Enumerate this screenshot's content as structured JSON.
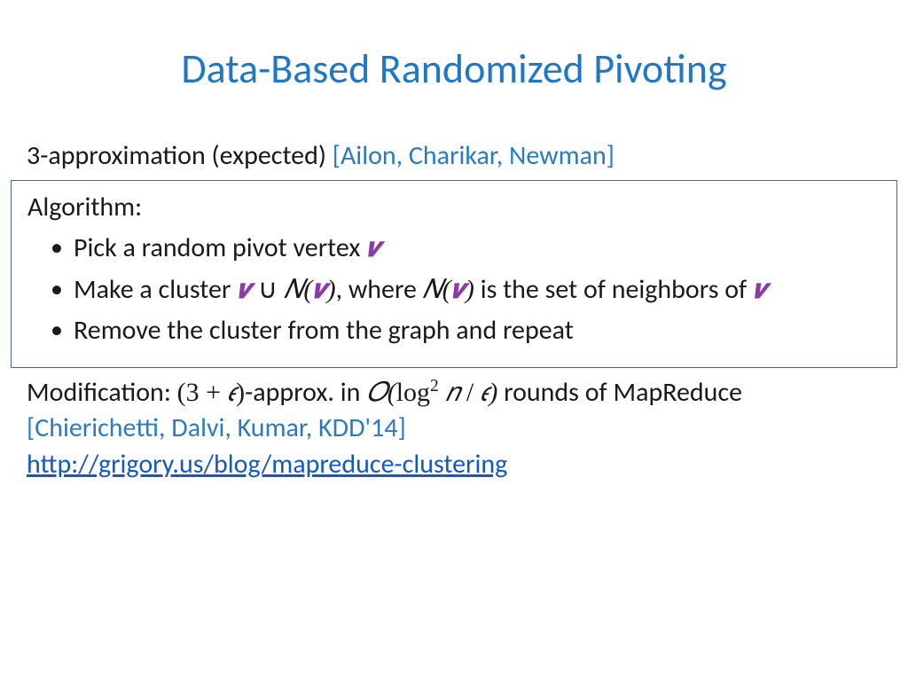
{
  "title": "Data-Based Randomized Pivoting",
  "approx_prefix": "3-approximation (expected) ",
  "citation1": "[Ailon, Charikar, Newman]",
  "algorithm_label": "Algorithm:",
  "bullet1_pre": "Pick a random pivot vertex ",
  "bullet2_pre": "Make a cluster ",
  "bullet2_mid1": ", where ",
  "bullet2_mid2": " is the set of neighbors of ",
  "bullet3": "Remove the cluster from the graph and repeat",
  "mod_prefix": "Modification: ",
  "mod_approx_text": "-approx. in ",
  "mod_rounds": " rounds of MapReduce ",
  "citation2": "[Chierichetti, Dalvi, Kumar, KDD'14]",
  "url": "http://grigory.us/blog/mapreduce-clustering",
  "v": "𝒗",
  "N_open": "𝑁(",
  "N_close": ")",
  "union": " ∪ ",
  "mod_expr_open": "(3 + ",
  "mod_expr_close": ")",
  "eps": "𝜖",
  "bigO_open": "𝑂(",
  "logsq": "log",
  "sq": "2",
  "n": " 𝑛 ",
  "slash": "/ ",
  "bigO_close": ")"
}
